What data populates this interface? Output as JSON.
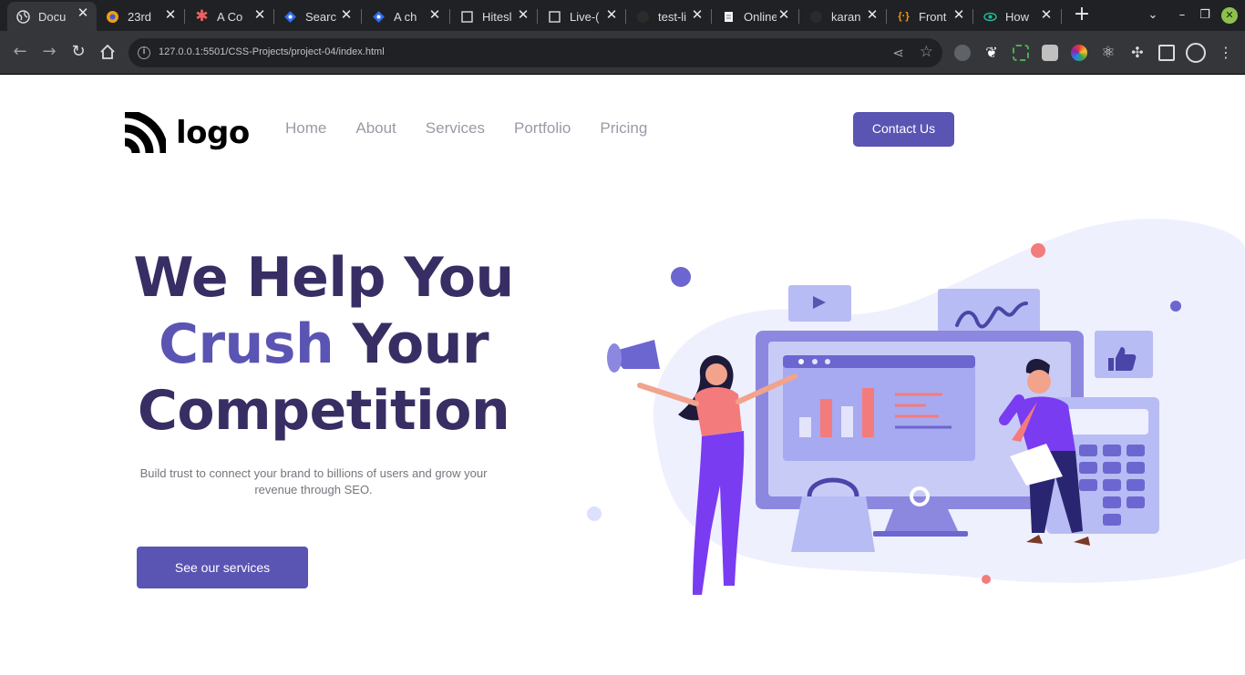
{
  "browser": {
    "tabs": [
      {
        "title": "Docu",
        "icon": "globe-icon",
        "active": true
      },
      {
        "title": "23rd",
        "icon": "orange-circle-icon"
      },
      {
        "title": "A Co",
        "icon": "asterisk-icon"
      },
      {
        "title": "Searc",
        "icon": "blue-diamond-icon"
      },
      {
        "title": "A ch",
        "icon": "blue-diamond-icon"
      },
      {
        "title": "Hitesl",
        "icon": "square-icon"
      },
      {
        "title": "Live-(",
        "icon": "square-icon"
      },
      {
        "title": "test-li",
        "icon": "github-icon"
      },
      {
        "title": "Online",
        "icon": "notepad-icon"
      },
      {
        "title": "karan",
        "icon": "github-icon"
      },
      {
        "title": "Front",
        "icon": "braces-icon"
      },
      {
        "title": "How",
        "icon": "eye-icon"
      }
    ],
    "url": "127.0.0.1:5501/CSS-Projects/project-04/index.html"
  },
  "header": {
    "logo_text": "logo",
    "nav": [
      "Home",
      "About",
      "Services",
      "Portfolio",
      "Pricing"
    ],
    "contact_label": "Contact Us"
  },
  "hero": {
    "title_line1": "We Help You",
    "title_accent": "Crush",
    "title_line2_rest": " Your",
    "title_line3": "Competition",
    "subtitle": "Build trust to connect your brand to billions of users and grow your revenue through SEO.",
    "cta_label": "See our services"
  },
  "colors": {
    "primary": "#5a54b3",
    "heading": "#382e64",
    "nav_text": "#9a9aa6",
    "chrome_dark": "#202124",
    "chrome_toolbar": "#35363a"
  }
}
